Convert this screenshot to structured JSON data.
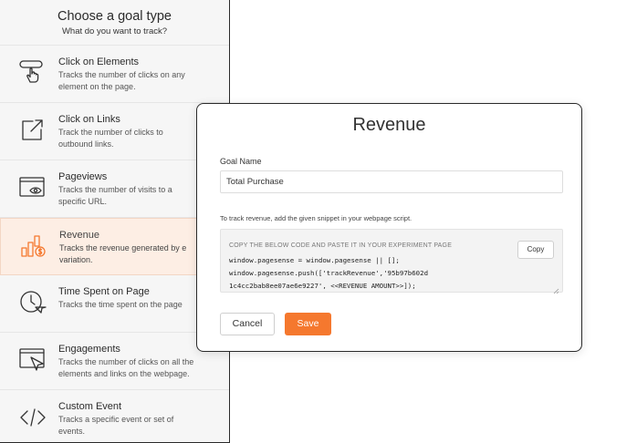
{
  "panel": {
    "title": "Choose a goal type",
    "subtitle": "What do you want to track?",
    "items": [
      {
        "name": "Click on Elements",
        "desc1": "Tracks the number of clicks on any",
        "desc2": "element on the page.",
        "icon": "pointer-click-icon"
      },
      {
        "name": "Click on Links",
        "desc1": "Track the number of clicks to",
        "desc2": "outbound links.",
        "icon": "external-link-icon"
      },
      {
        "name": "Pageviews",
        "desc1": "Tracks the number of visits to a",
        "desc2": "specific URL.",
        "icon": "browser-eye-icon"
      },
      {
        "name": "Revenue",
        "desc1": "Tracks the revenue generated by e",
        "desc2": "variation.",
        "icon": "revenue-bars-icon"
      },
      {
        "name": "Time Spent on Page",
        "desc1": "Tracks the time spent on the page",
        "desc2": "",
        "icon": "clock-icon"
      },
      {
        "name": "Engagements",
        "desc1": "Tracks the number of clicks on all the",
        "desc2": "elements and links on the webpage.",
        "icon": "browser-cursor-icon"
      },
      {
        "name": "Custom Event",
        "desc1": "Tracks a specific event or set of",
        "desc2": "events.",
        "icon": "code-icon"
      }
    ]
  },
  "modal": {
    "title": "Revenue",
    "goal_name_label": "Goal Name",
    "goal_name_value": "Total Purchase",
    "hint": "To track revenue, add the given snippet in your webpage script.",
    "code_heading": "COPY THE BELOW CODE AND PASTE IT IN YOUR EXPERIMENT PAGE",
    "code_line1": "window.pagesense = window.pagesense || [];",
    "code_line2": "window.pagesense.push(['trackRevenue','95b97b602d",
    "code_line3": "1c4cc2bab8ee07ae6e9227', <<REVENUE AMOUNT>>]);",
    "copy_label": "Copy",
    "cancel_label": "Cancel",
    "save_label": "Save"
  },
  "colors": {
    "accent": "#f5782e",
    "active_bg": "#fdeee4"
  }
}
